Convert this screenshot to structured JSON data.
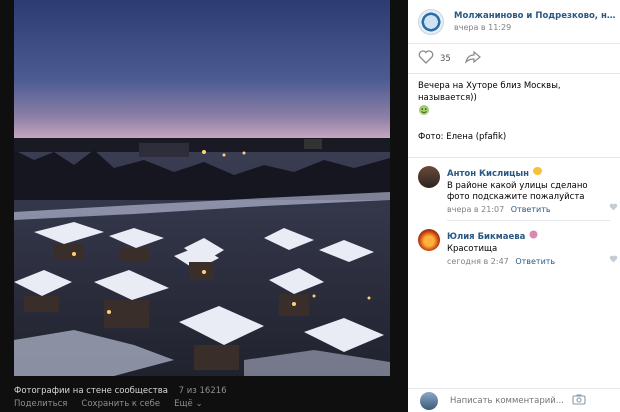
{
  "viewer": {
    "album_label": "Фотографии на стене сообщества",
    "counter": "7 из 16216",
    "share_label": "Поделиться",
    "save_label": "Сохранить к себе",
    "more_label": "Ещё ⌄"
  },
  "post": {
    "group_name": "Молжаниново и Подрезково, наде...",
    "time": "вчера в 11:29",
    "likes": "35",
    "text": "Вечера на Хуторе близ Москвы, называется))",
    "credit": "Фото: Елена (pfafik)"
  },
  "comments": [
    {
      "author": "Антон Кислицын",
      "text": "В районе какой улицы сделано фото подскажите пожалуйста",
      "time": "вчера в 21:07",
      "reply": "Ответить"
    },
    {
      "author": "Юлия Бикмаева",
      "text": "Красотища",
      "time": "сегодня в 2:47",
      "reply": "Ответить"
    }
  ],
  "comment_box": {
    "placeholder": "Написать комментарий..."
  },
  "colors": {
    "link": "#2a5885",
    "meta": "#828282",
    "viewer_bg": "#0f0f0f"
  }
}
